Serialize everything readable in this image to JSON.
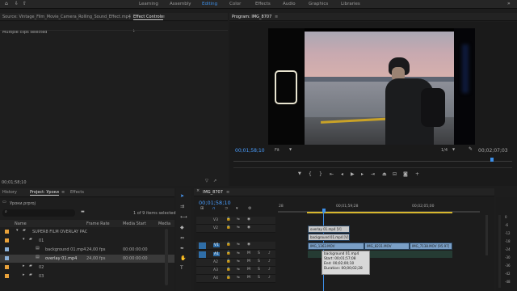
{
  "workspaces": [
    "Learning",
    "Assembly",
    "Editing",
    "Color",
    "Effects",
    "Audio",
    "Graphics",
    "Libraries"
  ],
  "source": {
    "title": "Source: Vintage_Film_Movie_Camera_Rolling_Sound_Effect.mp4",
    "effect_controls": "Effect Controls",
    "multiple": "Multiple clips selected",
    "timecode": "00;01;58;10"
  },
  "program": {
    "title": "Program: IMG_8707",
    "timecode": "00;01;58;10",
    "fit": "Fit",
    "quality": "1/4",
    "duration": "00;02;07;03"
  },
  "project": {
    "tabs": [
      "History",
      "Project: Уроки",
      "Effects"
    ],
    "file": "Уроки.prproj",
    "count": "1 of 9 items selected",
    "cols": [
      "Name",
      "Frame Rate",
      "Media Start",
      "Media"
    ],
    "rows": [
      {
        "name": "SUPER8 FILM OVERLAY PAC",
        "rate": "",
        "start": ""
      },
      {
        "name": "01",
        "rate": "",
        "start": ""
      },
      {
        "name": "background 01.mp4",
        "rate": "24,00 fps",
        "start": "00:00:00:00"
      },
      {
        "name": "overlay 01.mp4",
        "rate": "24,00 fps",
        "start": "00:00:00:00"
      },
      {
        "name": "02",
        "rate": "",
        "start": ""
      },
      {
        "name": "03",
        "rate": "",
        "start": ""
      }
    ]
  },
  "timeline": {
    "seq": "IMG_8707",
    "timecode": "00;01;58;10",
    "ruler": [
      "28",
      "00;01;59;28",
      "00;02;05;00"
    ],
    "tracks": [
      "V3",
      "V2",
      "V1",
      "A1",
      "A2",
      "A3",
      "A4"
    ],
    "clips": {
      "overlay": "overlay 01.mp4 [V]",
      "background": "background 01.mp4 [V]",
      "c1": "IMG_1363.MOV",
      "c2": "IMG_8231.MOV",
      "c3": "IMG_7138.MOV [95.97]"
    },
    "tooltip": [
      "background 01.mp4",
      "Start: 00;01;57;08",
      "End: 00;02;00;10",
      "Duration: 00;00;02;28"
    ]
  },
  "meter": [
    "0",
    "-6",
    "-12",
    "-18",
    "-24",
    "-30",
    "-36",
    "-42",
    "-48"
  ],
  "colors": {
    "accent": "#3d8fe8",
    "clip_blue": "#8ab0d8",
    "clip_v": "#7a9fc6",
    "bg": "#1d1d1d"
  }
}
